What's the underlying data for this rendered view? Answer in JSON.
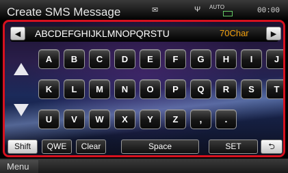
{
  "title": "Create SMS Message",
  "status": {
    "envelope_icon": "envelope-icon",
    "antenna_icon": "antenna-icon",
    "auto_label": "AUTO",
    "clock": "00:00"
  },
  "input": {
    "text": "ABCDEFGHIJKLMNOPQRSTU",
    "char_count": "70Char",
    "left_icon": "cursor-left-icon",
    "right_icon": "cursor-right-icon"
  },
  "keys": {
    "row1": [
      "A",
      "B",
      "C",
      "D",
      "E",
      "F",
      "G",
      "H",
      "I",
      "J"
    ],
    "row2": [
      "K",
      "L",
      "M",
      "N",
      "O",
      "P",
      "Q",
      "R",
      "S",
      "T"
    ],
    "row3": [
      "U",
      "V",
      "W",
      "X",
      "Y",
      "Z",
      ",",
      "."
    ]
  },
  "function_keys": {
    "shift": "Shift",
    "qwe": "QWE",
    "clear": "Clear",
    "space": "Space",
    "set": "SET",
    "back_icon": "return-icon"
  },
  "menu": {
    "label": "Menu"
  },
  "colors": {
    "frame_border": "#d8111e",
    "char_count": "#f4a10e"
  }
}
